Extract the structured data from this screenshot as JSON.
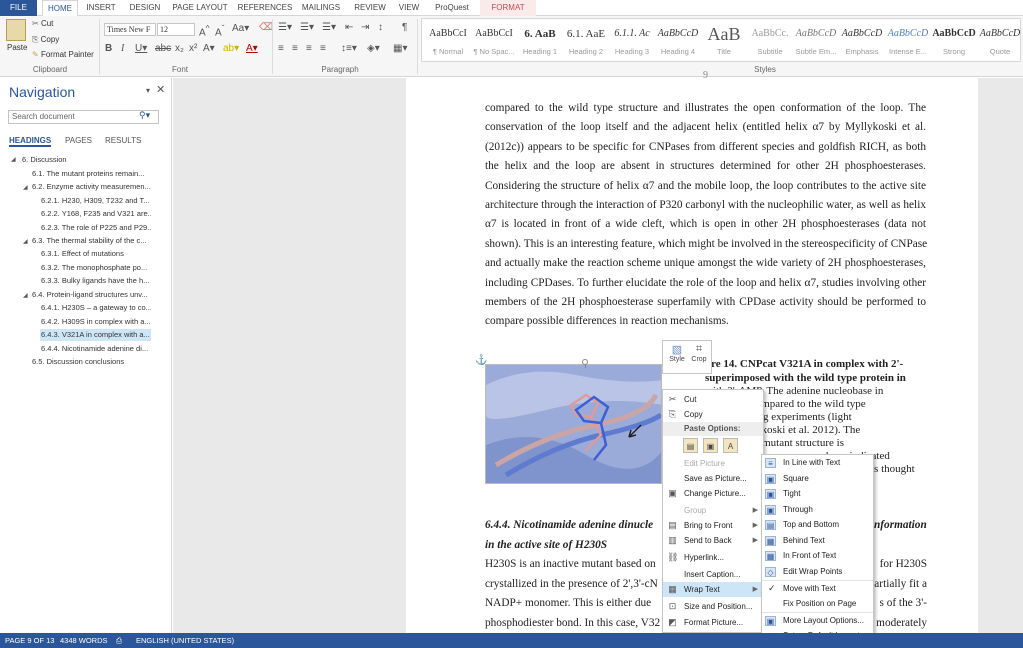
{
  "tabs": {
    "file": "FILE",
    "home": "HOME",
    "insert": "INSERT",
    "design": "DESIGN",
    "page_layout": "PAGE LAYOUT",
    "references": "REFERENCES",
    "mailings": "MAILINGS",
    "review": "REVIEW",
    "view": "VIEW",
    "proquest": "ProQuest",
    "format": "FORMAT"
  },
  "clipboard": {
    "paste": "Paste",
    "cut": "Cut",
    "copy": "Copy",
    "format_painter": "Format Painter",
    "label": "Clipboard"
  },
  "font": {
    "name": "Times New F",
    "size": "12",
    "label": "Font"
  },
  "paragraph": {
    "label": "Paragraph"
  },
  "styles": {
    "label": "Styles",
    "items": [
      {
        "preview": "AaBbCcI",
        "name": "¶ Normal"
      },
      {
        "preview": "AaBbCcI",
        "name": "¶ No Spac..."
      },
      {
        "preview": "6.  AaB",
        "name": "Heading 1"
      },
      {
        "preview": "6.1.  AaE",
        "name": "Heading 2"
      },
      {
        "preview": "6.1.1.  Ac",
        "name": "Heading 3"
      },
      {
        "preview": "AaBbCcD",
        "name": "Heading 4"
      },
      {
        "preview": "AaB",
        "name": "Title"
      },
      {
        "preview": "AaBbCc.",
        "name": "Subtitle"
      },
      {
        "preview": "AaBbCcD",
        "name": "Subtle Em..."
      },
      {
        "preview": "AaBbCcD",
        "name": "Emphasis"
      },
      {
        "preview": "AaBbCcD",
        "name": "Intense E..."
      },
      {
        "preview": "AaBbCcD",
        "name": "Strong"
      },
      {
        "preview": "AaBbCcD",
        "name": "Quote"
      }
    ]
  },
  "nav": {
    "title": "Navigation",
    "search_placeholder": "Search document",
    "tabs": [
      "HEADINGS",
      "PAGES",
      "RESULTS"
    ],
    "headings": [
      "6. Discussion",
      "6.1. The mutant proteins remain...",
      "6.2. Enzyme activity measuremen...",
      "6.2.1.  H230, H309, T232 and T...",
      "6.2.2.  Y168, F235 and V321 are...",
      "6.2.3.  The role of P225 and P29...",
      "6.3. The thermal stability of the c...",
      "6.3.1.  Effect of mutations",
      "6.3.2.  The monophosphate po...",
      "6.3.3.  Bulky ligands have the h...",
      "6.4. Protein-ligand structures unv...",
      "6.4.1.  H230S – a gateway to co...",
      "6.4.2.  H309S in complex with a...",
      "6.4.3.  V321A in complex with a...",
      "6.4.4.  Nicotinamide adenine di...",
      "6.5. Discussion conclusions"
    ]
  },
  "doc": {
    "para1": [
      "compared to the wild type structure and illustrates the open conformation of the loop. The",
      "conservation of the loop itself and the adjacent helix (entitled helix α7 by Myllykoski et al.",
      "(2012c)) appears to be specific for CNPases from different species and goldfish RICH, as both",
      "the helix and the loop are absent in structures determined for other 2H phosphoesterases.",
      "Considering the structure of helix α7 and the mobile loop, the loop contributes to the active site",
      "architecture through the interaction of P320 carbonyl with the nucleophilic water, as well as helix",
      "α7 is located in front of a wide cleft, which is open in other 2H phosphoesterases (data not",
      "shown). This is an interesting feature, which might be involved in the stereospecificity of CNPase",
      "and actually make the reaction scheme unique amongst the wide variety of 2H phosphoesterases,",
      "including CPDases. To further elucidate the role of the loop and helix α7, studies involving other",
      "members of the 2H phosphoesterase superfamily with CPDase activity should be performed to",
      "compare possible differences in reaction mechanisms."
    ],
    "caption": [
      "ure 14. CNPcat V321A in complex with 2'-",
      "superimposed with the wild type protein in",
      "with 2'-AMP. The adenine nucleobase in",
      "as flipped compared to the wild type",
      "ed via soaking experiments (light",
      "YDD; Myllykoski et al. 2012). The",
      "which in the mutant structure is",
      "been indicated",
      "is thought"
    ],
    "heading644_left": "6.4.4.   Nicotinamide adenine dinucle",
    "heading644_right": "nformation",
    "heading644_line2": "in the active site of H230S",
    "para2": [
      [
        "H230S is an inactive mutant based on",
        "for H230S"
      ],
      [
        "crystallized in the presence of 2',3'-cN",
        "artially fit a"
      ],
      [
        "NADP+ monomer. This is either due",
        "s of the 3'-"
      ],
      [
        "phosphodiester bond. In this case, V32",
        "moderately"
      ]
    ],
    "page_mark": "9"
  },
  "picture_tools": {
    "style": "Style",
    "crop": "Crop"
  },
  "context_menu": {
    "items": [
      {
        "label": "Cut",
        "icon": "✂",
        "disabled": false
      },
      {
        "label": "Copy",
        "icon": "⎘",
        "disabled": false
      },
      {
        "label": "Paste Options:",
        "header": true
      },
      {
        "label": "",
        "paste_icons": true
      },
      {
        "label": "Edit Picture",
        "disabled": true
      },
      {
        "label": "Save as Picture...",
        "disabled": false
      },
      {
        "label": "Change Picture...",
        "icon": "▣",
        "disabled": false
      },
      {
        "label": "Group",
        "disabled": true,
        "arrow": true
      },
      {
        "label": "Bring to Front",
        "icon": "▤",
        "disabled": false,
        "arrow": true
      },
      {
        "label": "Send to Back",
        "icon": "▥",
        "disabled": false,
        "arrow": true
      },
      {
        "label": "Hyperlink...",
        "icon": "⛓",
        "disabled": false
      },
      {
        "label": "Insert Caption...",
        "disabled": false
      },
      {
        "label": "Wrap Text",
        "icon": "▦",
        "disabled": false,
        "arrow": true,
        "highlight": true
      },
      {
        "label": "Size and Position...",
        "icon": "⊡",
        "disabled": false
      },
      {
        "label": "Format Picture...",
        "icon": "◩",
        "disabled": false
      }
    ]
  },
  "wrap_menu": {
    "items": [
      {
        "label": "In Line with Text",
        "icon": "≡"
      },
      {
        "label": "Square",
        "icon": "▣"
      },
      {
        "label": "Tight",
        "icon": "▣"
      },
      {
        "label": "Through",
        "icon": "▣"
      },
      {
        "label": "Top and Bottom",
        "icon": "▤"
      },
      {
        "label": "Behind Text",
        "icon": "▦"
      },
      {
        "label": "In Front of Text",
        "icon": "▦"
      },
      {
        "label": "Edit Wrap Points",
        "icon": "◇"
      },
      {
        "label": "Move with Text",
        "check": "✓"
      },
      {
        "label": "Fix Position on Page"
      },
      {
        "label": "More Layout Options...",
        "icon": "▣"
      },
      {
        "label": "Set as Default Layout"
      }
    ]
  },
  "status": {
    "page": "PAGE 9 OF 13",
    "words": "4348 WORDS",
    "lang": "ENGLISH (UNITED STATES)"
  },
  "colors": {
    "accent": "#2b579a",
    "format_tab": "#c0504d",
    "highlight": "#cde6f7"
  }
}
